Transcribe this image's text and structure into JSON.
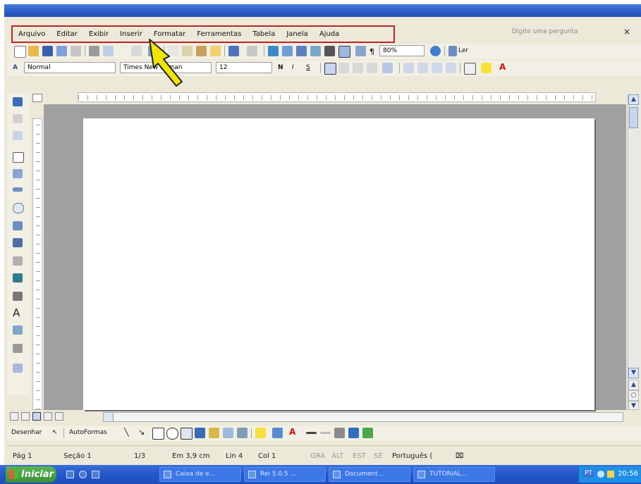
{
  "menu": {
    "items": [
      "Arquivo",
      "Editar",
      "Exibir",
      "Inserir",
      "Formatar",
      "Ferramentas",
      "Tabela",
      "Janela",
      "Ajuda"
    ],
    "ask_placeholder": "Digite uma pergunta",
    "close_symbol": "×"
  },
  "standard_toolbar": {
    "zoom": "80%",
    "read_label": "Ler"
  },
  "formatting_toolbar": {
    "style_value": "Normal",
    "font_value": "Times New Roman",
    "size_value": "12",
    "bold": "N",
    "italic": "I",
    "underline": "S"
  },
  "drawing_toolbar": {
    "draw_label": "Desenhar",
    "autoshapes_label": "AutoFormas"
  },
  "status_bar": {
    "page": "Pág 1",
    "section": "Seção 1",
    "page_of": "1/3",
    "position": "Em 3,9 cm",
    "line": "Lin 4",
    "column": "Col 1",
    "rec": "GRA",
    "trk": "ALT",
    "ext": "EST",
    "ovr": "SE",
    "language": "Português ("
  },
  "taskbar": {
    "start_label": "Iniciar",
    "buttons": [
      "Caixa de e...",
      "Rei 5.0.5 ...",
      "Document...",
      "TUTORIAL..."
    ],
    "language_tag": "PT",
    "clock": "20:56"
  },
  "colors": {
    "highlight_box": "#c0222c",
    "annotation_arrow": "#f2e600",
    "taskbar": "#2457c8"
  }
}
